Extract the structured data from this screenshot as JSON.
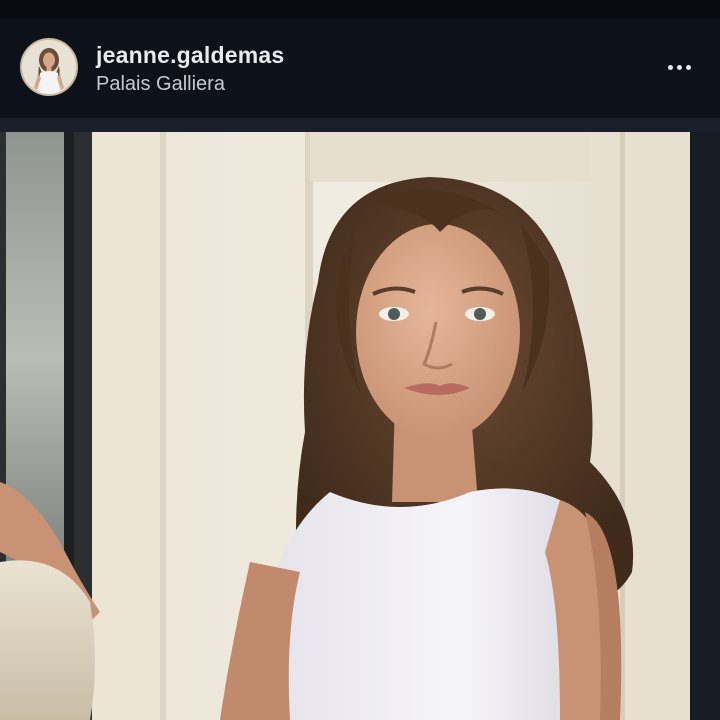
{
  "post": {
    "username": "jeanne.galdemas",
    "location": "Palais Galliera",
    "avatar_icon": "profile-photo",
    "more_icon": "ellipsis-horizontal-icon",
    "photo_subject": "portrait"
  },
  "colors": {
    "background": "#0d1119",
    "username_text": "#e8eaee",
    "location_text": "#c7cad1",
    "avatar_ring": "#c9b79c"
  }
}
